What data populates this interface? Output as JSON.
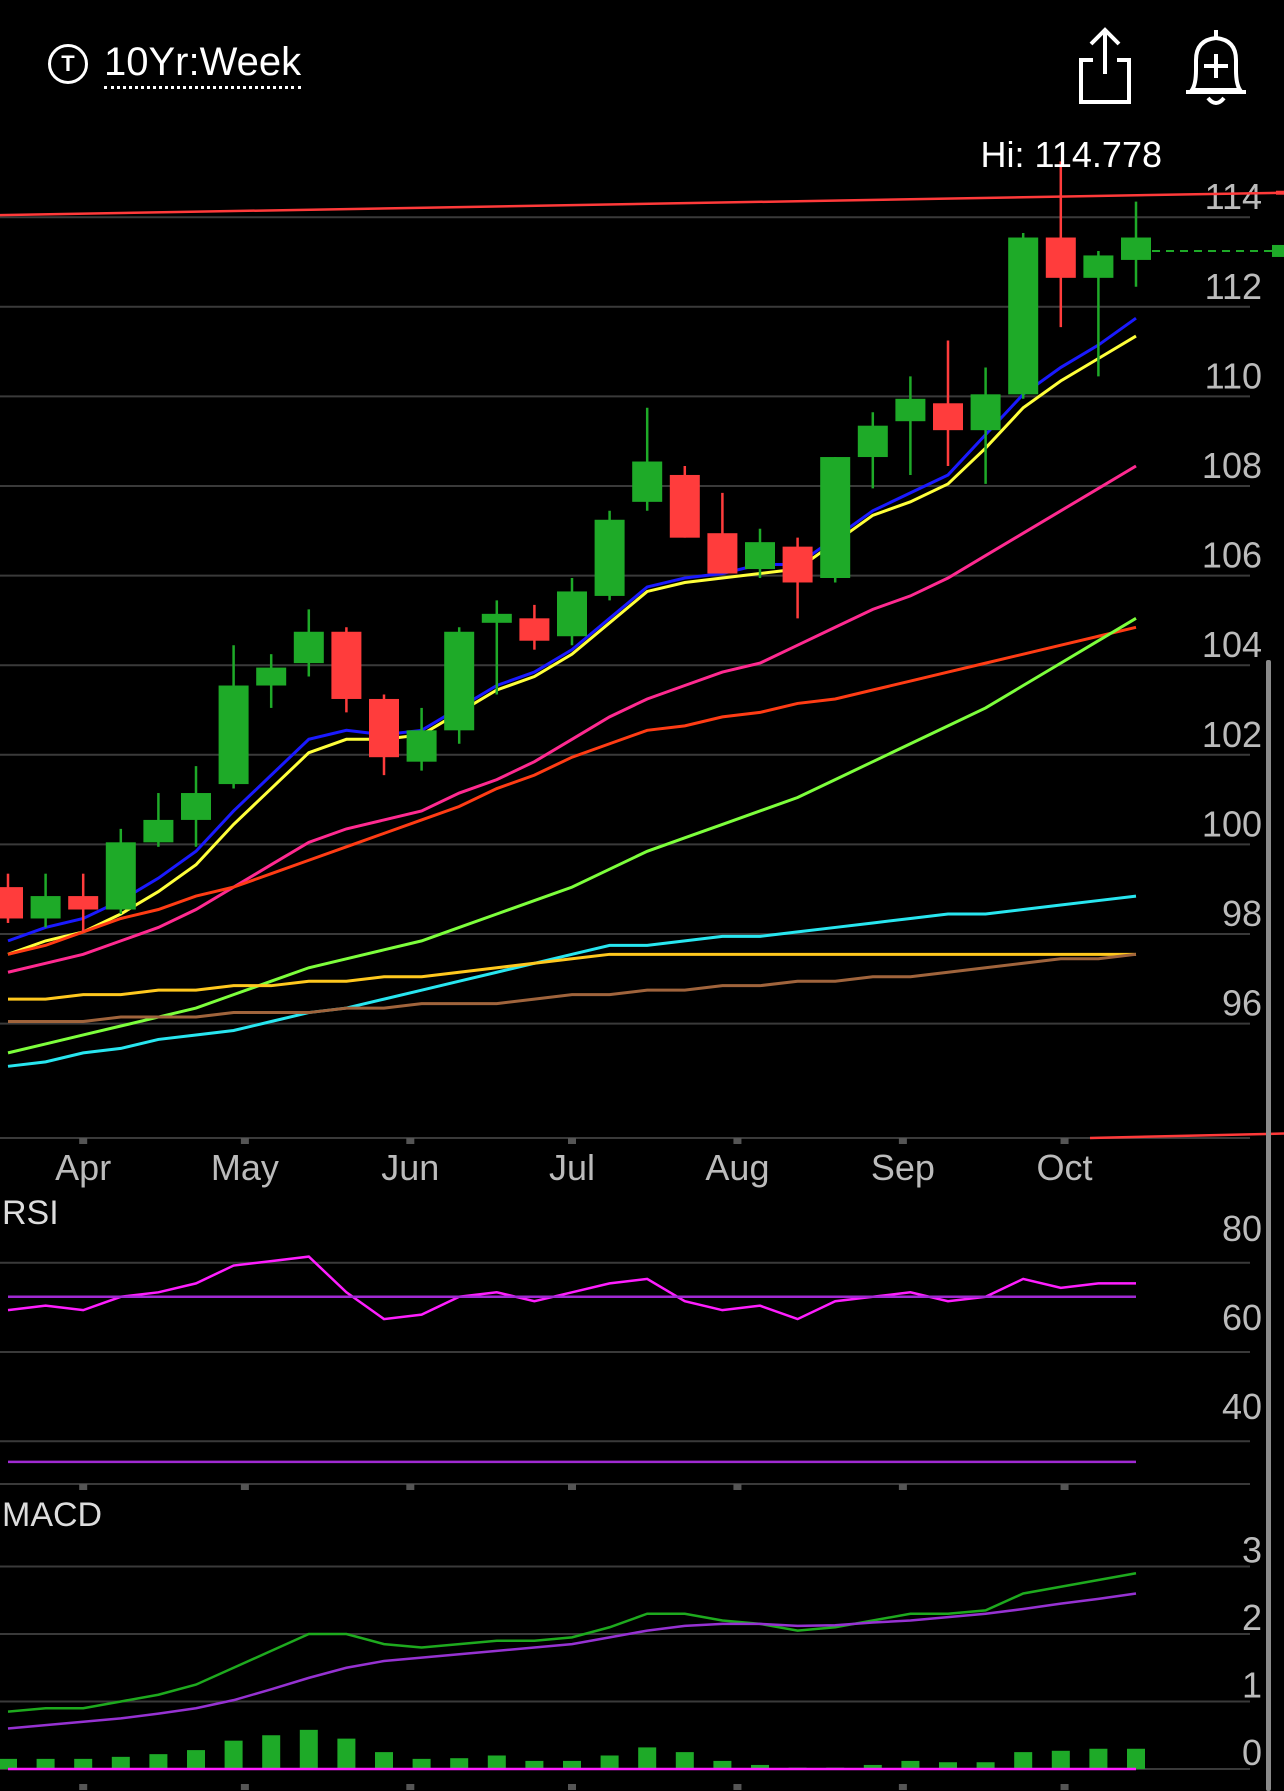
{
  "header": {
    "title": "10Yr:Week",
    "title_icon": "T",
    "hi_label": "Hi: 114.778"
  },
  "chart_data": [
    {
      "type": "candlestick",
      "title": "10Yr:Week",
      "ylim": [
        93,
        115.5
      ],
      "y_ticks": [
        "114",
        "112",
        "110",
        "108",
        "106",
        "104",
        "102",
        "100",
        "98",
        "96"
      ],
      "x_ticks": [
        "Apr",
        "May",
        "Jun",
        "Jul",
        "Aug",
        "Sep",
        "Oct"
      ],
      "x_tick_index": [
        2,
        6.3,
        10.7,
        15,
        19.4,
        23.8,
        28.1
      ],
      "candles": [
        {
          "o": 98.6,
          "h": 98.9,
          "l": 97.8,
          "c": 97.9
        },
        {
          "o": 97.9,
          "h": 98.9,
          "l": 97.7,
          "c": 98.4
        },
        {
          "o": 98.4,
          "h": 98.9,
          "l": 97.6,
          "c": 98.1
        },
        {
          "o": 98.1,
          "h": 99.9,
          "l": 98.0,
          "c": 99.6
        },
        {
          "o": 99.6,
          "h": 100.7,
          "l": 99.5,
          "c": 100.1
        },
        {
          "o": 100.1,
          "h": 101.3,
          "l": 99.5,
          "c": 100.7
        },
        {
          "o": 100.9,
          "h": 104.0,
          "l": 100.8,
          "c": 103.1
        },
        {
          "o": 103.1,
          "h": 103.8,
          "l": 102.6,
          "c": 103.5
        },
        {
          "o": 103.6,
          "h": 104.8,
          "l": 103.3,
          "c": 104.3
        },
        {
          "o": 104.3,
          "h": 104.4,
          "l": 102.5,
          "c": 102.8
        },
        {
          "o": 102.8,
          "h": 102.9,
          "l": 101.1,
          "c": 101.5
        },
        {
          "o": 101.4,
          "h": 102.6,
          "l": 101.2,
          "c": 102.1
        },
        {
          "o": 102.1,
          "h": 104.4,
          "l": 101.8,
          "c": 104.3
        },
        {
          "o": 104.5,
          "h": 105.0,
          "l": 102.9,
          "c": 104.7
        },
        {
          "o": 104.6,
          "h": 104.9,
          "l": 103.9,
          "c": 104.1
        },
        {
          "o": 104.2,
          "h": 105.5,
          "l": 104.0,
          "c": 105.2
        },
        {
          "o": 105.1,
          "h": 107.0,
          "l": 105.0,
          "c": 106.8
        },
        {
          "o": 107.2,
          "h": 109.3,
          "l": 107.0,
          "c": 108.1
        },
        {
          "o": 107.8,
          "h": 108.0,
          "l": 106.4,
          "c": 106.4
        },
        {
          "o": 106.5,
          "h": 107.4,
          "l": 105.7,
          "c": 105.6
        },
        {
          "o": 105.7,
          "h": 106.6,
          "l": 105.5,
          "c": 106.3
        },
        {
          "o": 106.2,
          "h": 106.4,
          "l": 104.6,
          "c": 105.4
        },
        {
          "o": 105.5,
          "h": 108.2,
          "l": 105.4,
          "c": 108.2
        },
        {
          "o": 108.2,
          "h": 109.2,
          "l": 107.5,
          "c": 108.9
        },
        {
          "o": 109.0,
          "h": 110.0,
          "l": 107.8,
          "c": 109.5
        },
        {
          "o": 109.4,
          "h": 110.8,
          "l": 108.0,
          "c": 108.8
        },
        {
          "o": 108.8,
          "h": 110.2,
          "l": 107.6,
          "c": 109.6
        },
        {
          "o": 109.6,
          "h": 113.2,
          "l": 109.5,
          "c": 113.1
        },
        {
          "o": 113.1,
          "h": 114.8,
          "l": 111.1,
          "c": 112.2
        },
        {
          "o": 112.2,
          "h": 112.8,
          "l": 110.0,
          "c": 112.7
        },
        {
          "o": 112.6,
          "h": 113.9,
          "l": 112.0,
          "c": 113.1
        }
      ],
      "last_price": 112.8,
      "trendline": {
        "start": 113.6,
        "end": 114.1
      },
      "lower_trendline_end": 93.1,
      "moving_averages": [
        {
          "color": "#1a1aff",
          "values": [
            97.4,
            97.7,
            97.9,
            98.3,
            98.8,
            99.4,
            100.3,
            101.1,
            101.9,
            102.1,
            102.0,
            102.1,
            102.6,
            103.1,
            103.4,
            103.9,
            104.6,
            105.3,
            105.5,
            105.6,
            105.8,
            105.8,
            106.4,
            107.0,
            107.4,
            107.8,
            108.7,
            109.6,
            110.2,
            110.7,
            111.3
          ]
        },
        {
          "color": "#ffff3a",
          "values": [
            97.1,
            97.4,
            97.6,
            98.0,
            98.5,
            99.1,
            100.0,
            100.8,
            101.6,
            101.9,
            101.9,
            102.0,
            102.5,
            103.0,
            103.3,
            103.8,
            104.5,
            105.2,
            105.4,
            105.5,
            105.6,
            105.7,
            106.3,
            106.9,
            107.2,
            107.6,
            108.4,
            109.3,
            109.9,
            110.4,
            110.9
          ]
        },
        {
          "color": "#ff2a90",
          "values": [
            96.7,
            96.9,
            97.1,
            97.4,
            97.7,
            98.1,
            98.6,
            99.1,
            99.6,
            99.9,
            100.1,
            100.3,
            100.7,
            101.0,
            101.4,
            101.9,
            102.4,
            102.8,
            103.1,
            103.4,
            103.6,
            104.0,
            104.4,
            104.8,
            105.1,
            105.5,
            106.0,
            106.5,
            107.0,
            107.5,
            108.0
          ]
        },
        {
          "color": "#ff3c14",
          "values": [
            97.1,
            97.3,
            97.6,
            97.9,
            98.1,
            98.4,
            98.6,
            98.9,
            99.2,
            99.5,
            99.8,
            100.1,
            100.4,
            100.8,
            101.1,
            101.5,
            101.8,
            102.1,
            102.2,
            102.4,
            102.5,
            102.7,
            102.8,
            103.0,
            103.2,
            103.4,
            103.6,
            103.8,
            104.0,
            104.2,
            104.4
          ]
        },
        {
          "color": "#7dff3c",
          "values": [
            94.9,
            95.1,
            95.3,
            95.5,
            95.7,
            95.9,
            96.2,
            96.5,
            96.8,
            97.0,
            97.2,
            97.4,
            97.7,
            98.0,
            98.3,
            98.6,
            99.0,
            99.4,
            99.7,
            100.0,
            100.3,
            100.6,
            101.0,
            101.4,
            101.8,
            102.2,
            102.6,
            103.1,
            103.6,
            104.1,
            104.6
          ]
        },
        {
          "color": "#28e6f0",
          "values": [
            94.6,
            94.7,
            94.9,
            95.0,
            95.2,
            95.3,
            95.4,
            95.6,
            95.8,
            95.9,
            96.1,
            96.3,
            96.5,
            96.7,
            96.9,
            97.1,
            97.3,
            97.3,
            97.4,
            97.5,
            97.5,
            97.6,
            97.7,
            97.8,
            97.9,
            98.0,
            98.0,
            98.1,
            98.2,
            98.3,
            98.4
          ]
        },
        {
          "color": "#ffc81e",
          "values": [
            96.1,
            96.1,
            96.2,
            96.2,
            96.3,
            96.3,
            96.4,
            96.4,
            96.5,
            96.5,
            96.6,
            96.6,
            96.7,
            96.8,
            96.9,
            97.0,
            97.1,
            97.1,
            97.1,
            97.1,
            97.1,
            97.1,
            97.1,
            97.1,
            97.1,
            97.1,
            97.1,
            97.1,
            97.1,
            97.1,
            97.1
          ]
        },
        {
          "color": "#a0643c",
          "values": [
            95.6,
            95.6,
            95.6,
            95.7,
            95.7,
            95.7,
            95.8,
            95.8,
            95.8,
            95.9,
            95.9,
            96.0,
            96.0,
            96.0,
            96.1,
            96.2,
            96.2,
            96.3,
            96.3,
            96.4,
            96.4,
            96.5,
            96.5,
            96.6,
            96.6,
            96.7,
            96.8,
            96.9,
            97.0,
            97.0,
            97.1
          ]
        }
      ]
    },
    {
      "type": "line",
      "title": "RSI",
      "ylim": [
        34,
        86
      ],
      "y_ticks": [
        "80",
        "60",
        "40"
      ],
      "series": [
        {
          "color": "#ff1eff",
          "values": [
            64,
            65,
            64,
            67,
            68,
            70,
            74,
            75,
            76,
            68,
            62,
            63,
            67,
            68,
            66,
            68,
            70,
            71,
            66,
            64,
            65,
            62,
            66,
            67,
            68,
            66,
            67,
            71,
            69,
            70,
            70
          ]
        },
        {
          "color": "#a02ad2",
          "values": [
            67,
            67,
            67,
            67,
            67,
            67,
            67,
            67,
            67,
            67,
            67,
            67,
            67,
            67,
            67,
            67,
            67,
            67,
            67,
            67,
            67,
            67,
            67,
            67,
            67,
            67,
            67,
            67,
            67,
            67,
            67
          ]
        },
        {
          "color": "#a02ad2",
          "values": [
            30,
            30,
            30,
            30,
            30,
            30,
            30,
            30,
            30,
            30,
            30,
            30,
            30,
            30,
            30,
            30,
            30,
            30,
            30,
            30,
            30,
            30,
            30,
            30,
            30,
            30,
            30,
            30,
            30,
            30,
            30
          ]
        }
      ]
    },
    {
      "type": "line",
      "title": "MACD",
      "ylim": [
        -0.4,
        3.6
      ],
      "y_ticks": [
        "3",
        "2",
        "1",
        "0"
      ],
      "series": [
        {
          "color": "#1eaa1e",
          "values": [
            0.85,
            0.9,
            0.9,
            1.0,
            1.1,
            1.25,
            1.5,
            1.75,
            2.0,
            2.0,
            1.85,
            1.8,
            1.85,
            1.9,
            1.9,
            1.95,
            2.1,
            2.3,
            2.3,
            2.2,
            2.15,
            2.05,
            2.1,
            2.2,
            2.3,
            2.3,
            2.35,
            2.6,
            2.7,
            2.8,
            2.9
          ]
        },
        {
          "color": "#9632d2",
          "values": [
            0.6,
            0.65,
            0.7,
            0.75,
            0.82,
            0.9,
            1.02,
            1.18,
            1.35,
            1.5,
            1.6,
            1.65,
            1.7,
            1.75,
            1.8,
            1.85,
            1.95,
            2.05,
            2.12,
            2.15,
            2.15,
            2.12,
            2.13,
            2.17,
            2.2,
            2.25,
            2.3,
            2.37,
            2.45,
            2.52,
            2.6
          ]
        },
        {
          "color": "#ff1eff",
          "values": [
            0,
            0,
            0,
            0,
            0,
            0,
            0,
            0,
            0,
            0,
            0,
            0,
            0,
            0,
            0,
            0,
            0,
            0,
            0,
            0,
            0,
            0,
            0,
            0,
            0,
            0,
            0,
            0,
            0,
            0,
            0
          ]
        }
      ],
      "histogram": [
        0.15,
        0.15,
        0.15,
        0.18,
        0.22,
        0.28,
        0.42,
        0.5,
        0.58,
        0.45,
        0.25,
        0.15,
        0.16,
        0.2,
        0.12,
        0.12,
        0.2,
        0.32,
        0.25,
        0.12,
        0.06,
        0.02,
        0.02,
        0.06,
        0.12,
        0.1,
        0.1,
        0.25,
        0.27,
        0.3,
        0.3
      ]
    }
  ]
}
